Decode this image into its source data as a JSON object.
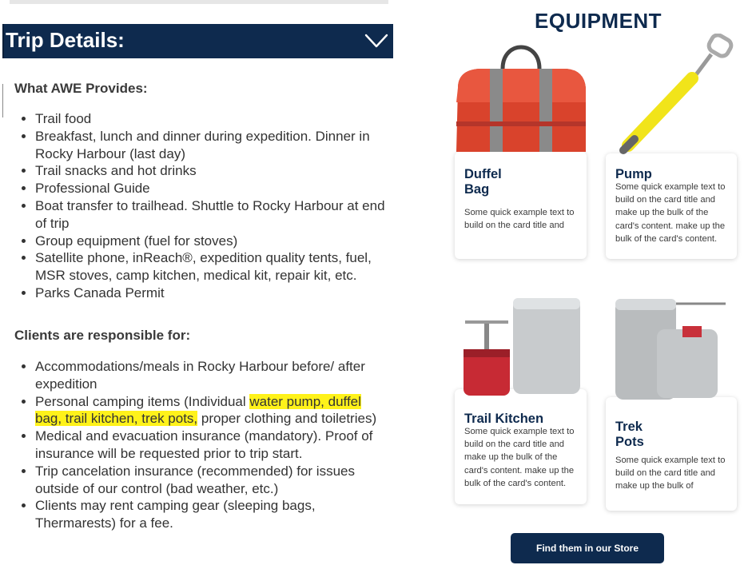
{
  "trip_details": {
    "title": "Trip Details:",
    "toggle_icon": "chevron-down-icon"
  },
  "provides": {
    "heading": "What AWE Provides:",
    "items": [
      "Trail food",
      "Breakfast, lunch and dinner during expedition. Dinner in Rocky Harbour (last day)",
      "Trail snacks and hot drinks",
      "Professional Guide",
      "Boat transfer to trailhead. Shuttle to Rocky Harbour at end of trip",
      "Group equipment (fuel for stoves)",
      "Satellite phone, inReach®, expedition quality tents, fuel, MSR stoves, camp kitchen, medical kit, repair kit, etc.",
      "Parks Canada Permit"
    ]
  },
  "responsible": {
    "heading": "Clients are responsible for:",
    "item_accommodations": "Accommodations/meals in Rocky Harbour before/ after expedition",
    "item_personal_prefix": "Personal camping items (Individual ",
    "item_personal_highlight": "water pump, duffel bag, trail kitchen, trek pots,",
    "item_personal_suffix": " proper clothing and toiletries)",
    "item_medical": "Medical and evacuation insurance (mandatory). Proof of insurance will be requested prior to trip start.",
    "item_cancel": "Trip cancelation insurance (recommended) for issues outside of our control (bad weather, etc.)",
    "item_rent": "Clients may rent camping gear (sleeping bags, Thermarests) for a fee.",
    "highlight_color": "#fff21a"
  },
  "equipment": {
    "title": "EQUIPMENT",
    "cards": [
      {
        "title_line1": "Duffel",
        "title_line2": "Bag",
        "text": "Some quick example text to build on the card title and",
        "image": "red-duffel-bag"
      },
      {
        "title_line1": "Pump",
        "title_line2": "",
        "text": "Some quick example text to build on the card title and make up the bulk of the card's content.  make up the bulk of the card's content.",
        "image": "yellow-water-pump"
      },
      {
        "title_line1": "Trail Kitchen",
        "title_line2": "",
        "text": "Some quick example text to build on the card title and make up the bulk of the card's content.  make up the bulk of the card's content.",
        "image": "camp-stove-and-pot"
      },
      {
        "title_line1": "Trek",
        "title_line2": "Pots",
        "text": "Some quick example text to build on the card title and make up the bulk of",
        "image": "trek-pot-set"
      }
    ],
    "store_button": "Find them in our Store"
  },
  "colors": {
    "navy": "#0e2a4e",
    "highlight": "#fff21a"
  }
}
